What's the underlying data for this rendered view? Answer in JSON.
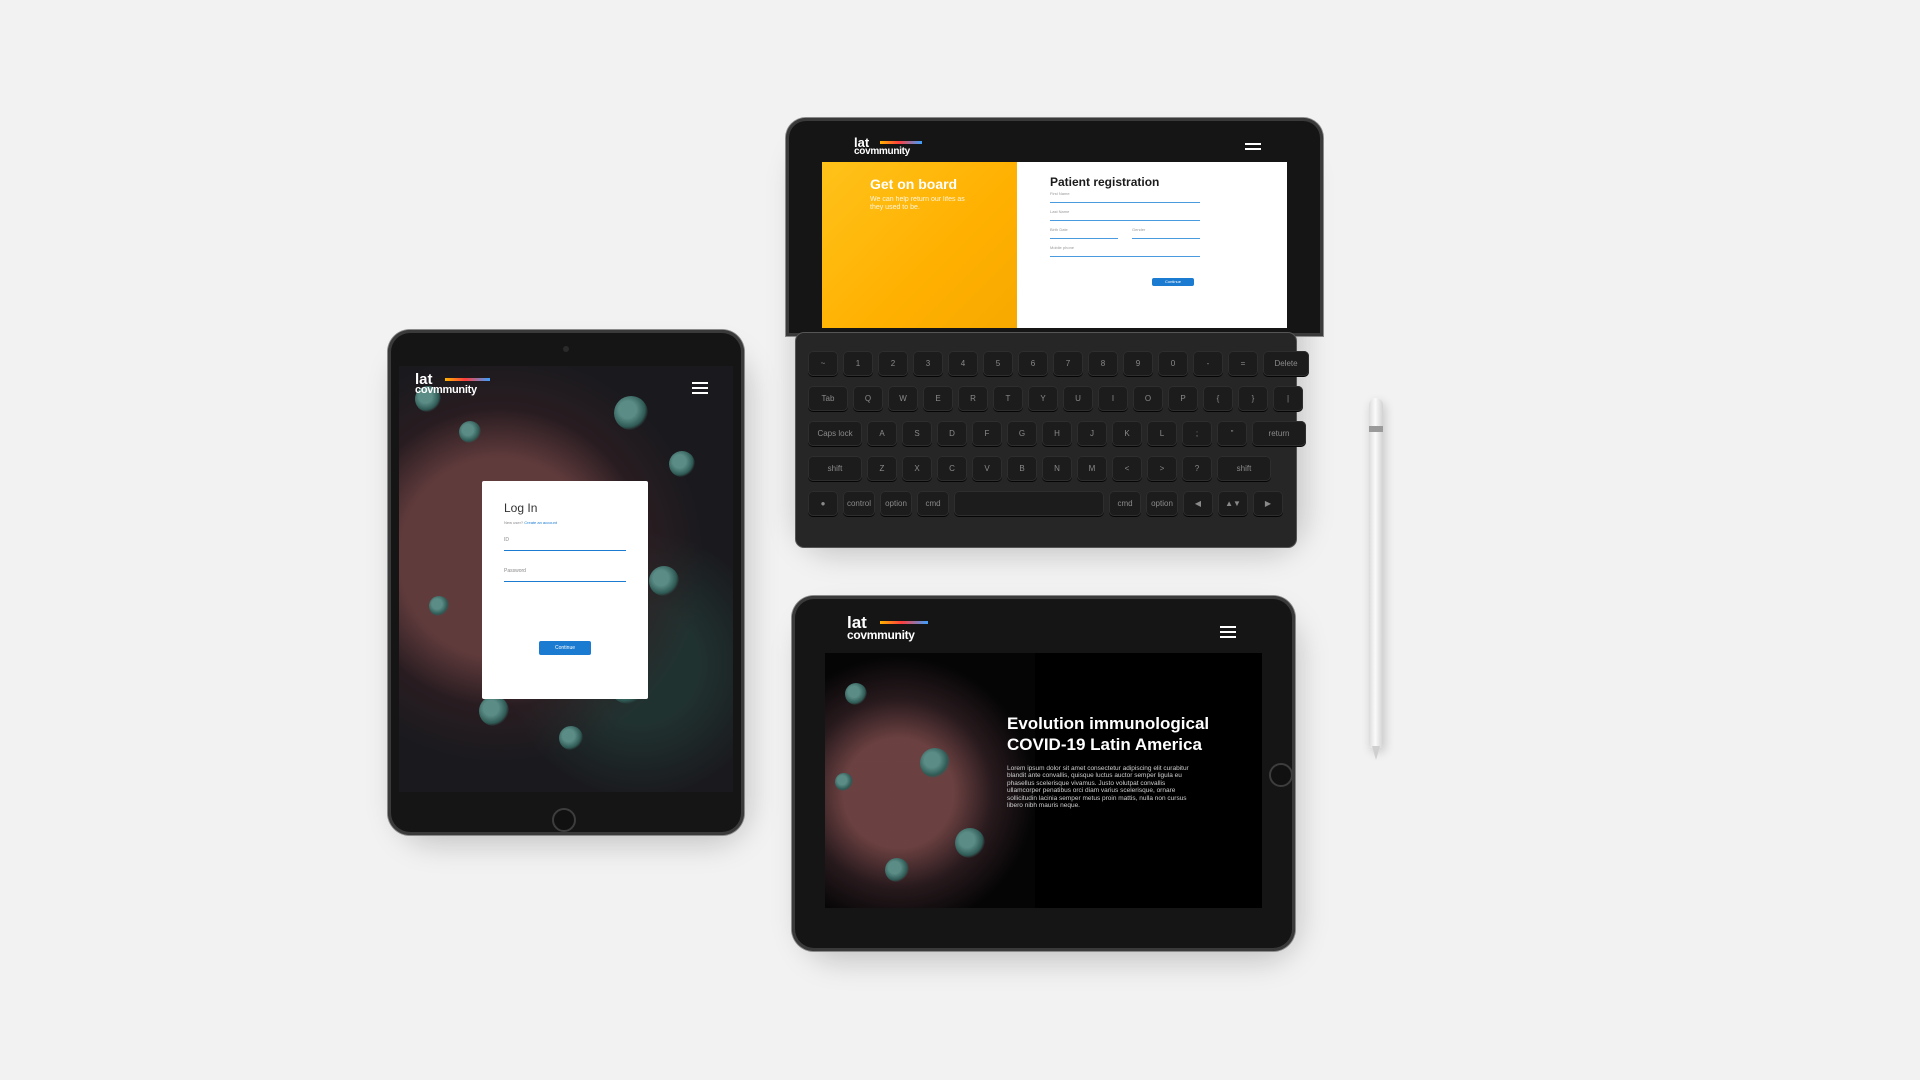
{
  "brand": {
    "line1": "lat",
    "line2": "covmmunity"
  },
  "login": {
    "title": "Log In",
    "subtitle": "New user?",
    "create_link": "Create an account",
    "field1_label": "ID",
    "field2_label": "Password",
    "button": "Continue"
  },
  "registration": {
    "panel_heading": "Get on board",
    "panel_text": "We can help return our lifes as they used to be.",
    "title": "Patient registration",
    "fields": {
      "first_name": "First Name",
      "last_name": "Last Name",
      "birth_date": "Birth Date",
      "gender": "Gender",
      "mobile": "Mobile phone"
    },
    "button": "Continue"
  },
  "hero": {
    "title_line1": "Evolution immunological",
    "title_line2": "COVID-19 Latin America",
    "body": "Lorem ipsum dolor sit amet consectetur adipiscing elit curabitur blandit ante convallis, quisque luctus auctor semper ligula eu phasellus scelerisque vivamus. Justo volutpat convallis ullamcorper penatibus orci diam varius scelerisque, ornare sollicitudin lacinia semper metus proin mattis, nulla non cursus libero nibh mauris neque."
  },
  "keyboard": {
    "row1": [
      "~",
      "1",
      "2",
      "3",
      "4",
      "5",
      "6",
      "7",
      "8",
      "9",
      "0",
      "-",
      "=",
      "Delete"
    ],
    "row2": [
      "Tab",
      "Q",
      "W",
      "E",
      "R",
      "T",
      "Y",
      "U",
      "I",
      "O",
      "P",
      "{",
      "}",
      "|"
    ],
    "row3": [
      "Caps lock",
      "A",
      "S",
      "D",
      "F",
      "G",
      "H",
      "J",
      "K",
      "L",
      ";",
      "\"",
      "return"
    ],
    "row4": [
      "shift",
      "Z",
      "X",
      "C",
      "V",
      "B",
      "N",
      "M",
      "<",
      ">",
      "?",
      "shift"
    ],
    "row5": [
      "●",
      "control",
      "option",
      "cmd",
      "",
      "cmd",
      "option",
      "◀",
      "▲▼",
      "▶"
    ]
  },
  "colors": {
    "background": "#f2f2f2",
    "accent_blue": "#1a7bd1",
    "accent_yellow": "#ffb800"
  },
  "icons": {
    "menu": "hamburger-menu-icon",
    "home_button": "home-button-icon"
  }
}
